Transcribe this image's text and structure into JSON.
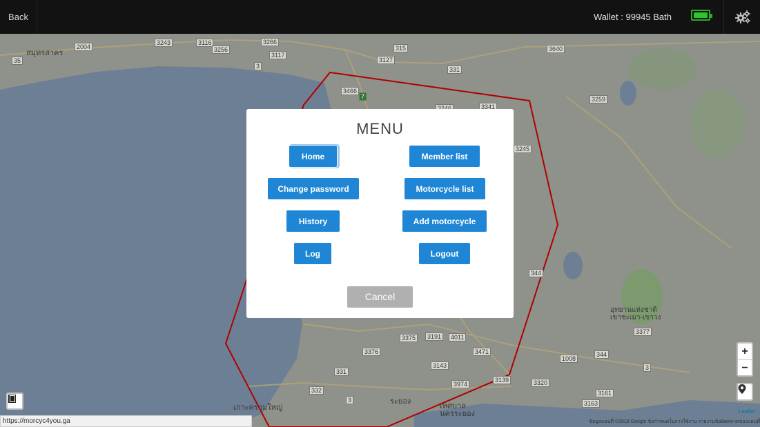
{
  "topbar": {
    "back_label": "Back",
    "wallet_text": "Wallet : 99945 Bath",
    "battery_icon": "battery-full-icon",
    "settings_icon": "gears-icon",
    "battery_color": "#2ec42e"
  },
  "map": {
    "road_labels": [
      "2004",
      "3243",
      "3116",
      "3256",
      "3266",
      "3117",
      "3",
      "315",
      "3640",
      "3127",
      "331",
      "3466",
      "7",
      "3259",
      "3246",
      "3341",
      "3245",
      "344",
      "3375",
      "3191",
      "4011",
      "3376",
      "3471",
      "3143",
      "331",
      "3974",
      "3139",
      "3320",
      "1008",
      "344",
      "3",
      "332",
      "3",
      "3161",
      "3163",
      "3377",
      "35"
    ],
    "place_labels": [
      "สมุทรสาคร",
      "เกาะครามใหญ่",
      "ระยอง",
      "เทศบาล นครระยอง",
      "อุทยานแห่งชาติ เขาชะเมา-เขาวง"
    ],
    "zoom_in": "+",
    "zoom_out": "−",
    "attribution": "ข้อมูลแผนที่ ©2018 Google   ข้อกำหนดในการใช้งาน   รายงานข้อผิดพลาดของแผนที่",
    "leaflet": "Leaflet",
    "boundary_color": "#b00000"
  },
  "modal": {
    "title": "MENU",
    "buttons": {
      "home": "Home",
      "member_list": "Member list",
      "change_password": "Change password",
      "motorcycle_list": "Motorcycle list",
      "history": "History",
      "add_motorcycle": "Add motorcycle",
      "log": "Log",
      "logout": "Logout"
    },
    "cancel": "Cancel",
    "accent": "#1e86d4"
  },
  "status_bar": {
    "url": "https://morcyc4you.ga"
  }
}
